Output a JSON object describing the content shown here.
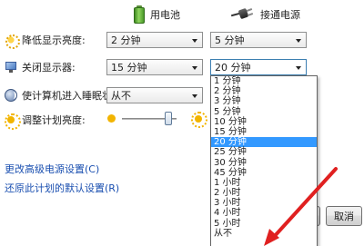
{
  "columns": {
    "battery": "用电池",
    "plugged": "接通电源"
  },
  "rows": [
    {
      "label": "降低显示亮度:",
      "battery_value": "2 分钟",
      "plugged_value": "5 分钟"
    },
    {
      "label": "关闭显示器:",
      "battery_value": "15 分钟",
      "plugged_value": "20 分钟"
    },
    {
      "label": "使计算机进入睡眠状态:",
      "battery_value": "从不"
    },
    {
      "label": "调整计划亮度:"
    }
  ],
  "brightness_level": 0.85,
  "dropdown": {
    "selected": "20 分钟",
    "options": [
      "1 分钟",
      "2 分钟",
      "3 分钟",
      "5 分钟",
      "10 分钟",
      "15 分钟",
      "20 分钟",
      "25 分钟",
      "30 分钟",
      "45 分钟",
      "1 小时",
      "2 小时",
      "3 小时",
      "4 小时",
      "5 小时",
      "从不"
    ]
  },
  "links": {
    "advanced": "更改高级电源设置(C)",
    "restore": "还原此计划的默认设置(R)"
  },
  "buttons": {
    "cancel": "取消"
  },
  "colors": {
    "selection": "#3399ff",
    "link": "#1a4fb0",
    "annotation_arrow": "#e02020"
  }
}
